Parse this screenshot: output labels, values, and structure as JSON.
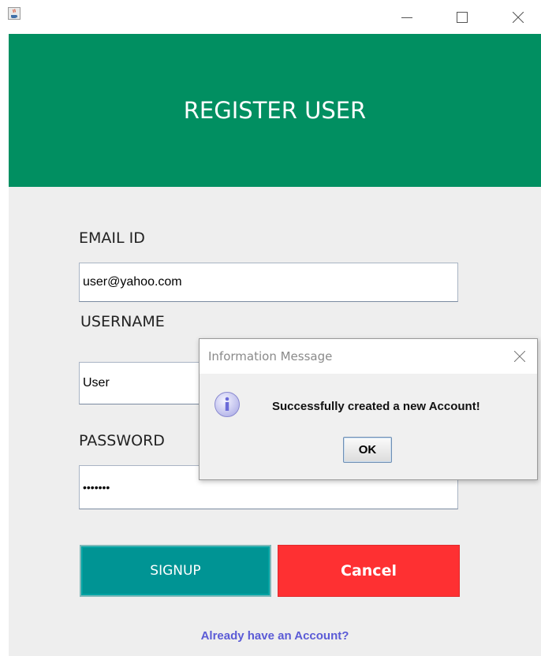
{
  "window": {
    "app_icon": "java-cup-icon",
    "minimize_icon": "minimize-icon",
    "maximize_icon": "maximize-icon",
    "close_icon": "close-icon"
  },
  "header": {
    "title": "REGISTER USER",
    "color": "#018f61"
  },
  "form": {
    "email_label": "EMAIL ID",
    "email_value": "user@yahoo.com",
    "username_label": "USERNAME",
    "username_value": "User",
    "password_label": "PASSWORD",
    "password_value": "•••••••"
  },
  "buttons": {
    "signup_label": "SIGNUP",
    "signup_color": "#009494",
    "cancel_label": "Cancel",
    "cancel_color": "#fe3032"
  },
  "link": {
    "account_text": "Already have an Account?"
  },
  "dialog": {
    "title": "Information Message",
    "message": "Successfully created a new Account!",
    "ok_label": "OK",
    "icon": "info-icon"
  }
}
